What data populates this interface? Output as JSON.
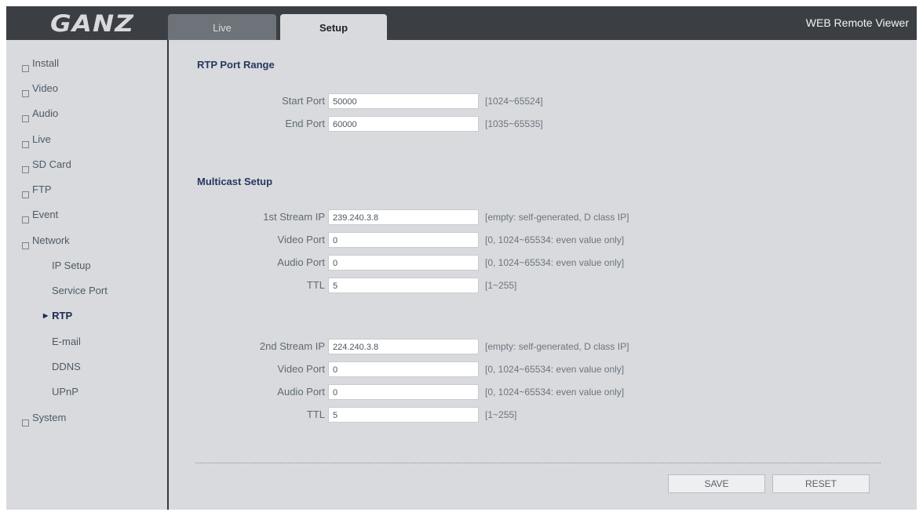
{
  "header": {
    "logo": "GANZ",
    "tabs": [
      {
        "label": "Live"
      },
      {
        "label": "Setup"
      }
    ],
    "app_title": "WEB Remote Viewer"
  },
  "sidebar": {
    "items": [
      {
        "label": "Install"
      },
      {
        "label": "Video"
      },
      {
        "label": "Audio"
      },
      {
        "label": "Live"
      },
      {
        "label": "SD Card"
      },
      {
        "label": "FTP"
      },
      {
        "label": "Event"
      },
      {
        "label": "Network"
      },
      {
        "label": "System"
      }
    ],
    "network_sub": [
      {
        "label": "IP Setup"
      },
      {
        "label": "Service Port"
      },
      {
        "label": "RTP"
      },
      {
        "label": "E-mail"
      },
      {
        "label": "DDNS"
      },
      {
        "label": "UPnP"
      }
    ]
  },
  "rtp": {
    "title": "RTP Port Range",
    "start_label": "Start Port",
    "start_value": "50000",
    "start_hint": "[1024~65524]",
    "end_label": "End Port",
    "end_value": "60000",
    "end_hint": "[1035~65535]"
  },
  "multicast": {
    "title": "Multicast Setup",
    "streams": [
      {
        "ip_label": "1st Stream IP",
        "ip_value": "239.240.3.8",
        "ip_hint": "[empty: self-generated, D class IP]",
        "video_label": "Video Port",
        "video_value": "0",
        "video_hint": "[0, 1024~65534: even value only]",
        "audio_label": "Audio Port",
        "audio_value": "0",
        "audio_hint": "[0, 1024~65534: even value only]",
        "ttl_label": "TTL",
        "ttl_value": "5",
        "ttl_hint": "[1~255]"
      },
      {
        "ip_label": "2nd Stream IP",
        "ip_value": "224.240.3.8",
        "ip_hint": "[empty: self-generated, D class IP]",
        "video_label": "Video Port",
        "video_value": "0",
        "video_hint": "[0, 1024~65534: even value only]",
        "audio_label": "Audio Port",
        "audio_value": "0",
        "audio_hint": "[0, 1024~65534: even value only]",
        "ttl_label": "TTL",
        "ttl_value": "5",
        "ttl_hint": "[1~255]"
      }
    ]
  },
  "buttons": {
    "save": "SAVE",
    "reset": "RESET"
  }
}
